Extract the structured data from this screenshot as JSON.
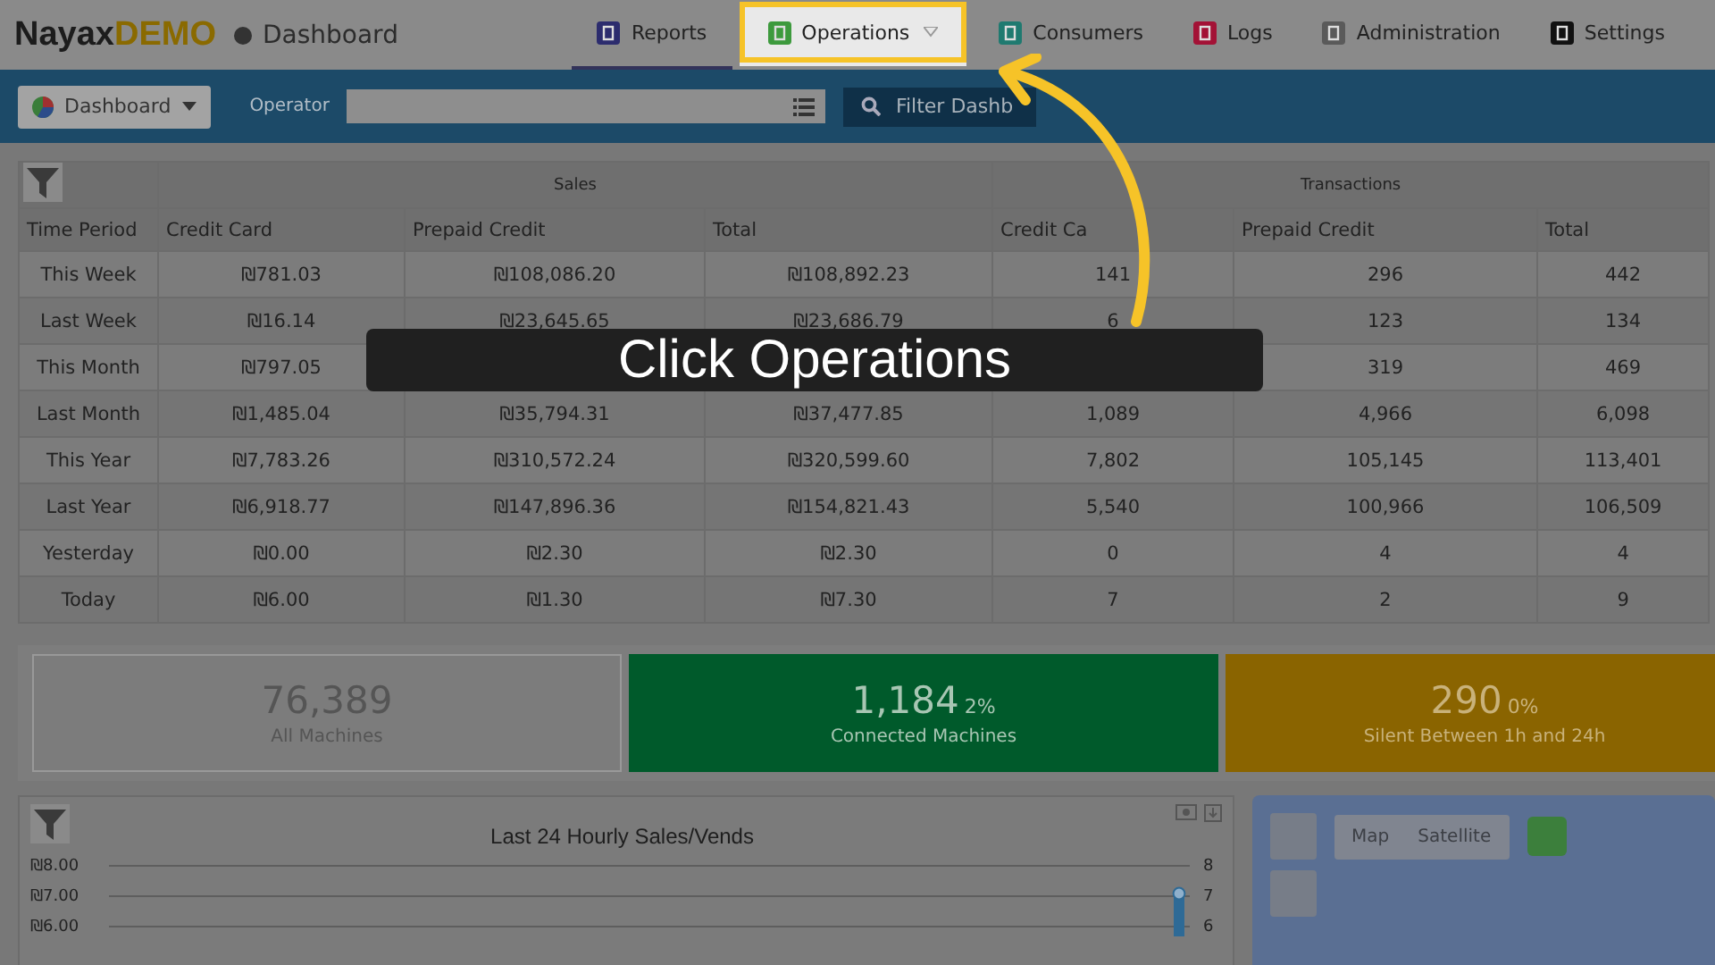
{
  "brand": {
    "name": "Nayax",
    "suffix": "DEMO",
    "page": "Dashboard"
  },
  "nav": [
    {
      "label": "Reports",
      "kind": "reports",
      "selected": true,
      "highlighted": false,
      "has_menu": false
    },
    {
      "label": "Operations",
      "kind": "operations",
      "selected": false,
      "highlighted": true,
      "has_menu": true
    },
    {
      "label": "Consumers",
      "kind": "consumers",
      "selected": false,
      "highlighted": false,
      "has_menu": false
    },
    {
      "label": "Logs",
      "kind": "logs",
      "selected": false,
      "highlighted": false,
      "has_menu": false
    },
    {
      "label": "Administration",
      "kind": "administration",
      "selected": false,
      "highlighted": false,
      "has_menu": false
    },
    {
      "label": "Settings",
      "kind": "settings",
      "selected": false,
      "highlighted": false,
      "has_menu": false
    }
  ],
  "toolbar": {
    "view": "Dashboard",
    "operator_label": "Operator",
    "filter_button": "Filter Dashb"
  },
  "table": {
    "groups": [
      "Sales",
      "Transactions"
    ],
    "columns": [
      "Time Period",
      "Credit Card",
      "Prepaid Credit",
      "Total",
      "Credit Ca",
      "Prepaid Credit",
      "Total"
    ],
    "rows": [
      [
        "This Week",
        "₪781.03",
        "₪108,086.20",
        "₪108,892.23",
        "141",
        "296",
        "442"
      ],
      [
        "Last Week",
        "₪16.14",
        "₪23,645.65",
        "₪23,686.79",
        "6",
        "123",
        "134"
      ],
      [
        "This Month",
        "₪797.05",
        null,
        null,
        null,
        "319",
        "469"
      ],
      [
        "Last Month",
        "₪1,485.04",
        "₪35,794.31",
        "₪37,477.85",
        "1,089",
        "4,966",
        "6,098"
      ],
      [
        "This Year",
        "₪7,783.26",
        "₪310,572.24",
        "₪320,599.60",
        "7,802",
        "105,145",
        "113,401"
      ],
      [
        "Last Year",
        "₪6,918.77",
        "₪147,896.36",
        "₪154,821.43",
        "5,540",
        "100,966",
        "106,509"
      ],
      [
        "Yesterday",
        "₪0.00",
        "₪2.30",
        "₪2.30",
        "0",
        "4",
        "4"
      ],
      [
        "Today",
        "₪6.00",
        "₪1.30",
        "₪7.30",
        "7",
        "2",
        "9"
      ]
    ]
  },
  "cards": [
    {
      "kind": "total",
      "value": "76,389",
      "label": "All Machines"
    },
    {
      "kind": "connected",
      "value": "1,184",
      "percent": "2%",
      "label": "Connected Machines"
    },
    {
      "kind": "silent",
      "value": "290",
      "percent": "0%",
      "label": "Silent Between 1h and 24h"
    }
  ],
  "chart": {
    "title": "Last 24 Hourly Sales/Vends",
    "left_ticks": [
      "₪8.00",
      "₪7.00",
      "₪6.00"
    ],
    "right_ticks": [
      "8",
      "7",
      "6"
    ]
  },
  "map": {
    "buttons": [
      "Map",
      "Satellite"
    ]
  },
  "caption": "Click Operations"
}
